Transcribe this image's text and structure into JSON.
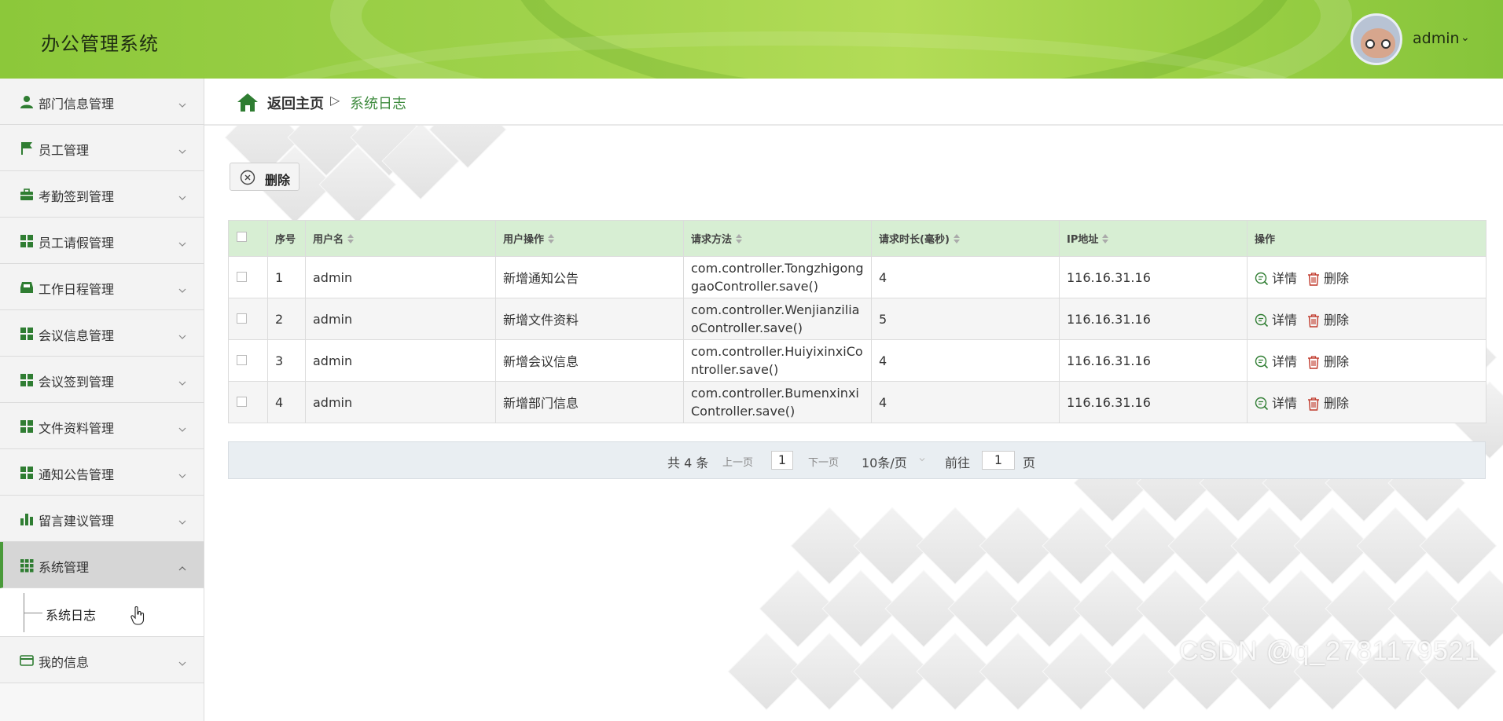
{
  "app": {
    "title": "办公管理系统"
  },
  "user": {
    "name": "admin"
  },
  "sidebar": {
    "items": [
      {
        "label": "部门信息管理",
        "icon": "user-icon"
      },
      {
        "label": "员工管理",
        "icon": "flag-icon"
      },
      {
        "label": "考勤签到管理",
        "icon": "briefcase-icon"
      },
      {
        "label": "员工请假管理",
        "icon": "grid-icon"
      },
      {
        "label": "工作日程管理",
        "icon": "inbox-icon"
      },
      {
        "label": "会议信息管理",
        "icon": "grid-icon"
      },
      {
        "label": "会议签到管理",
        "icon": "grid-icon"
      },
      {
        "label": "文件资料管理",
        "icon": "grid-icon"
      },
      {
        "label": "通知公告管理",
        "icon": "grid-icon"
      },
      {
        "label": "留言建议管理",
        "icon": "bar-chart-icon"
      },
      {
        "label": "系统管理",
        "icon": "apps-icon",
        "expanded": true
      },
      {
        "label": "我的信息",
        "icon": "card-icon"
      }
    ],
    "submenu": {
      "label": "系统日志"
    }
  },
  "breadcrumb": {
    "home": "返回主页",
    "separator": "▷",
    "current": "系统日志"
  },
  "toolbar": {
    "delete_label": "删除"
  },
  "table": {
    "columns": [
      "序号",
      "用户名",
      "用户操作",
      "请求方法",
      "请求时长(毫秒)",
      "IP地址",
      "操作"
    ],
    "rows": [
      {
        "index": "1",
        "username": "admin",
        "operation": "新增通知公告",
        "method": "com.controller.TongzhigonggaoController.save()",
        "duration": "4",
        "ip": "116.16.31.16"
      },
      {
        "index": "2",
        "username": "admin",
        "operation": "新增文件资料",
        "method": "com.controller.WenjianziliaoController.save()",
        "duration": "5",
        "ip": "116.16.31.16"
      },
      {
        "index": "3",
        "username": "admin",
        "operation": "新增会议信息",
        "method": "com.controller.HuiyixinxiController.save()",
        "duration": "4",
        "ip": "116.16.31.16"
      },
      {
        "index": "4",
        "username": "admin",
        "operation": "新增部门信息",
        "method": "com.controller.BumenxinxiController.save()",
        "duration": "4",
        "ip": "116.16.31.16"
      }
    ],
    "actions": {
      "detail": "详情",
      "delete": "删除"
    }
  },
  "pagination": {
    "total": "共 4 条",
    "prev": "上一页",
    "current_page": "1",
    "next": "下一页",
    "page_size": "10条/页",
    "goto_prefix": "前往",
    "goto_value": "1",
    "goto_suffix": "页"
  },
  "watermark": "CSDN @q_2781179521",
  "colors": {
    "accent": "#4a9a3a",
    "header_green": "#9fd24b",
    "table_header": "#d7eed3",
    "delete_red": "#c0392b"
  }
}
